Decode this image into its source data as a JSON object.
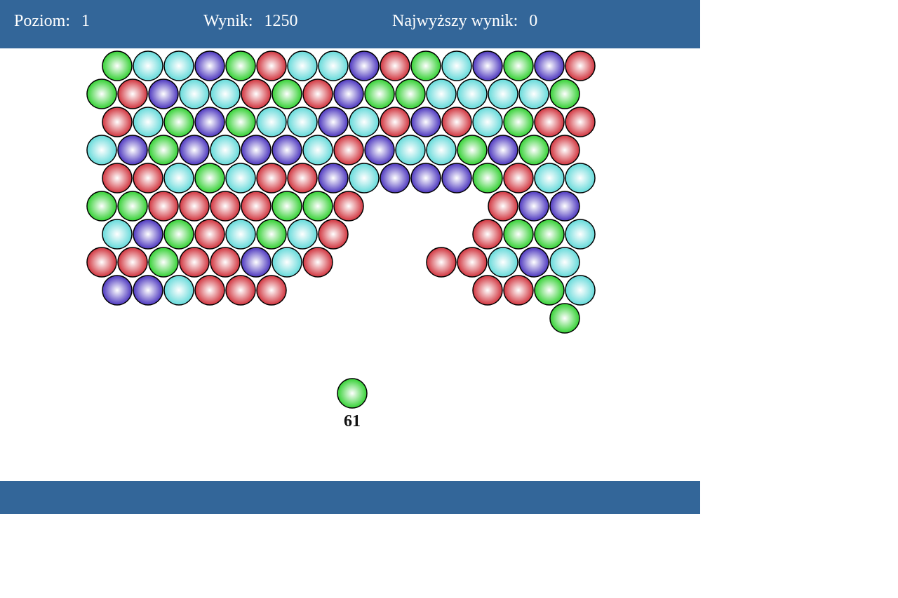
{
  "hud": {
    "level_label": "Poziom:",
    "level_value": "1",
    "score_label": "Wynik:",
    "score_value": "1250",
    "high_label": "Najwyższy wynik:",
    "high_value": "0"
  },
  "colors": {
    "G": "#1fcc1f",
    "C": "#55d6d6",
    "B": "#3a22b8",
    "R": "#cc1f2a",
    "bar": "#336699"
  },
  "grid": [
    [
      "G",
      "C",
      "C",
      "B",
      "G",
      "R",
      "C",
      "C",
      "B",
      "R",
      "G",
      "C",
      "B",
      "G",
      "B",
      "R"
    ],
    [
      "G",
      "R",
      "B",
      "C",
      "C",
      "R",
      "G",
      "R",
      "B",
      "G",
      "G",
      "C",
      "C",
      "C",
      "C",
      "G"
    ],
    [
      "R",
      "C",
      "G",
      "B",
      "G",
      "C",
      "C",
      "B",
      "C",
      "R",
      "B",
      "R",
      "C",
      "G",
      "R",
      "R"
    ],
    [
      "C",
      "B",
      "G",
      "B",
      "C",
      "B",
      "B",
      "C",
      "R",
      "B",
      "C",
      "C",
      "G",
      "B",
      "G",
      "R"
    ],
    [
      "R",
      "R",
      "C",
      "G",
      "C",
      "R",
      "R",
      "B",
      "C",
      "B",
      "B",
      "B",
      "G",
      "R",
      "C",
      "C"
    ],
    [
      "G",
      "G",
      "R",
      "R",
      "R",
      "R",
      "G",
      "G",
      "R",
      null,
      null,
      null,
      null,
      "R",
      "B",
      "B"
    ],
    [
      "C",
      "B",
      "G",
      "R",
      "C",
      "G",
      "C",
      "R",
      null,
      null,
      null,
      null,
      "R",
      "G",
      "G",
      "C"
    ],
    [
      "R",
      "R",
      "G",
      "R",
      "R",
      "B",
      "C",
      "R",
      null,
      null,
      null,
      "R",
      "R",
      "C",
      "B",
      "C"
    ],
    [
      "B",
      "B",
      "C",
      "R",
      "R",
      "R",
      null,
      null,
      null,
      null,
      null,
      null,
      "R",
      "R",
      "G",
      "C"
    ],
    [
      null,
      null,
      null,
      null,
      null,
      null,
      null,
      null,
      null,
      null,
      null,
      null,
      null,
      null,
      null,
      "G"
    ]
  ],
  "shooter": {
    "color": "G",
    "shots_left": "61"
  }
}
